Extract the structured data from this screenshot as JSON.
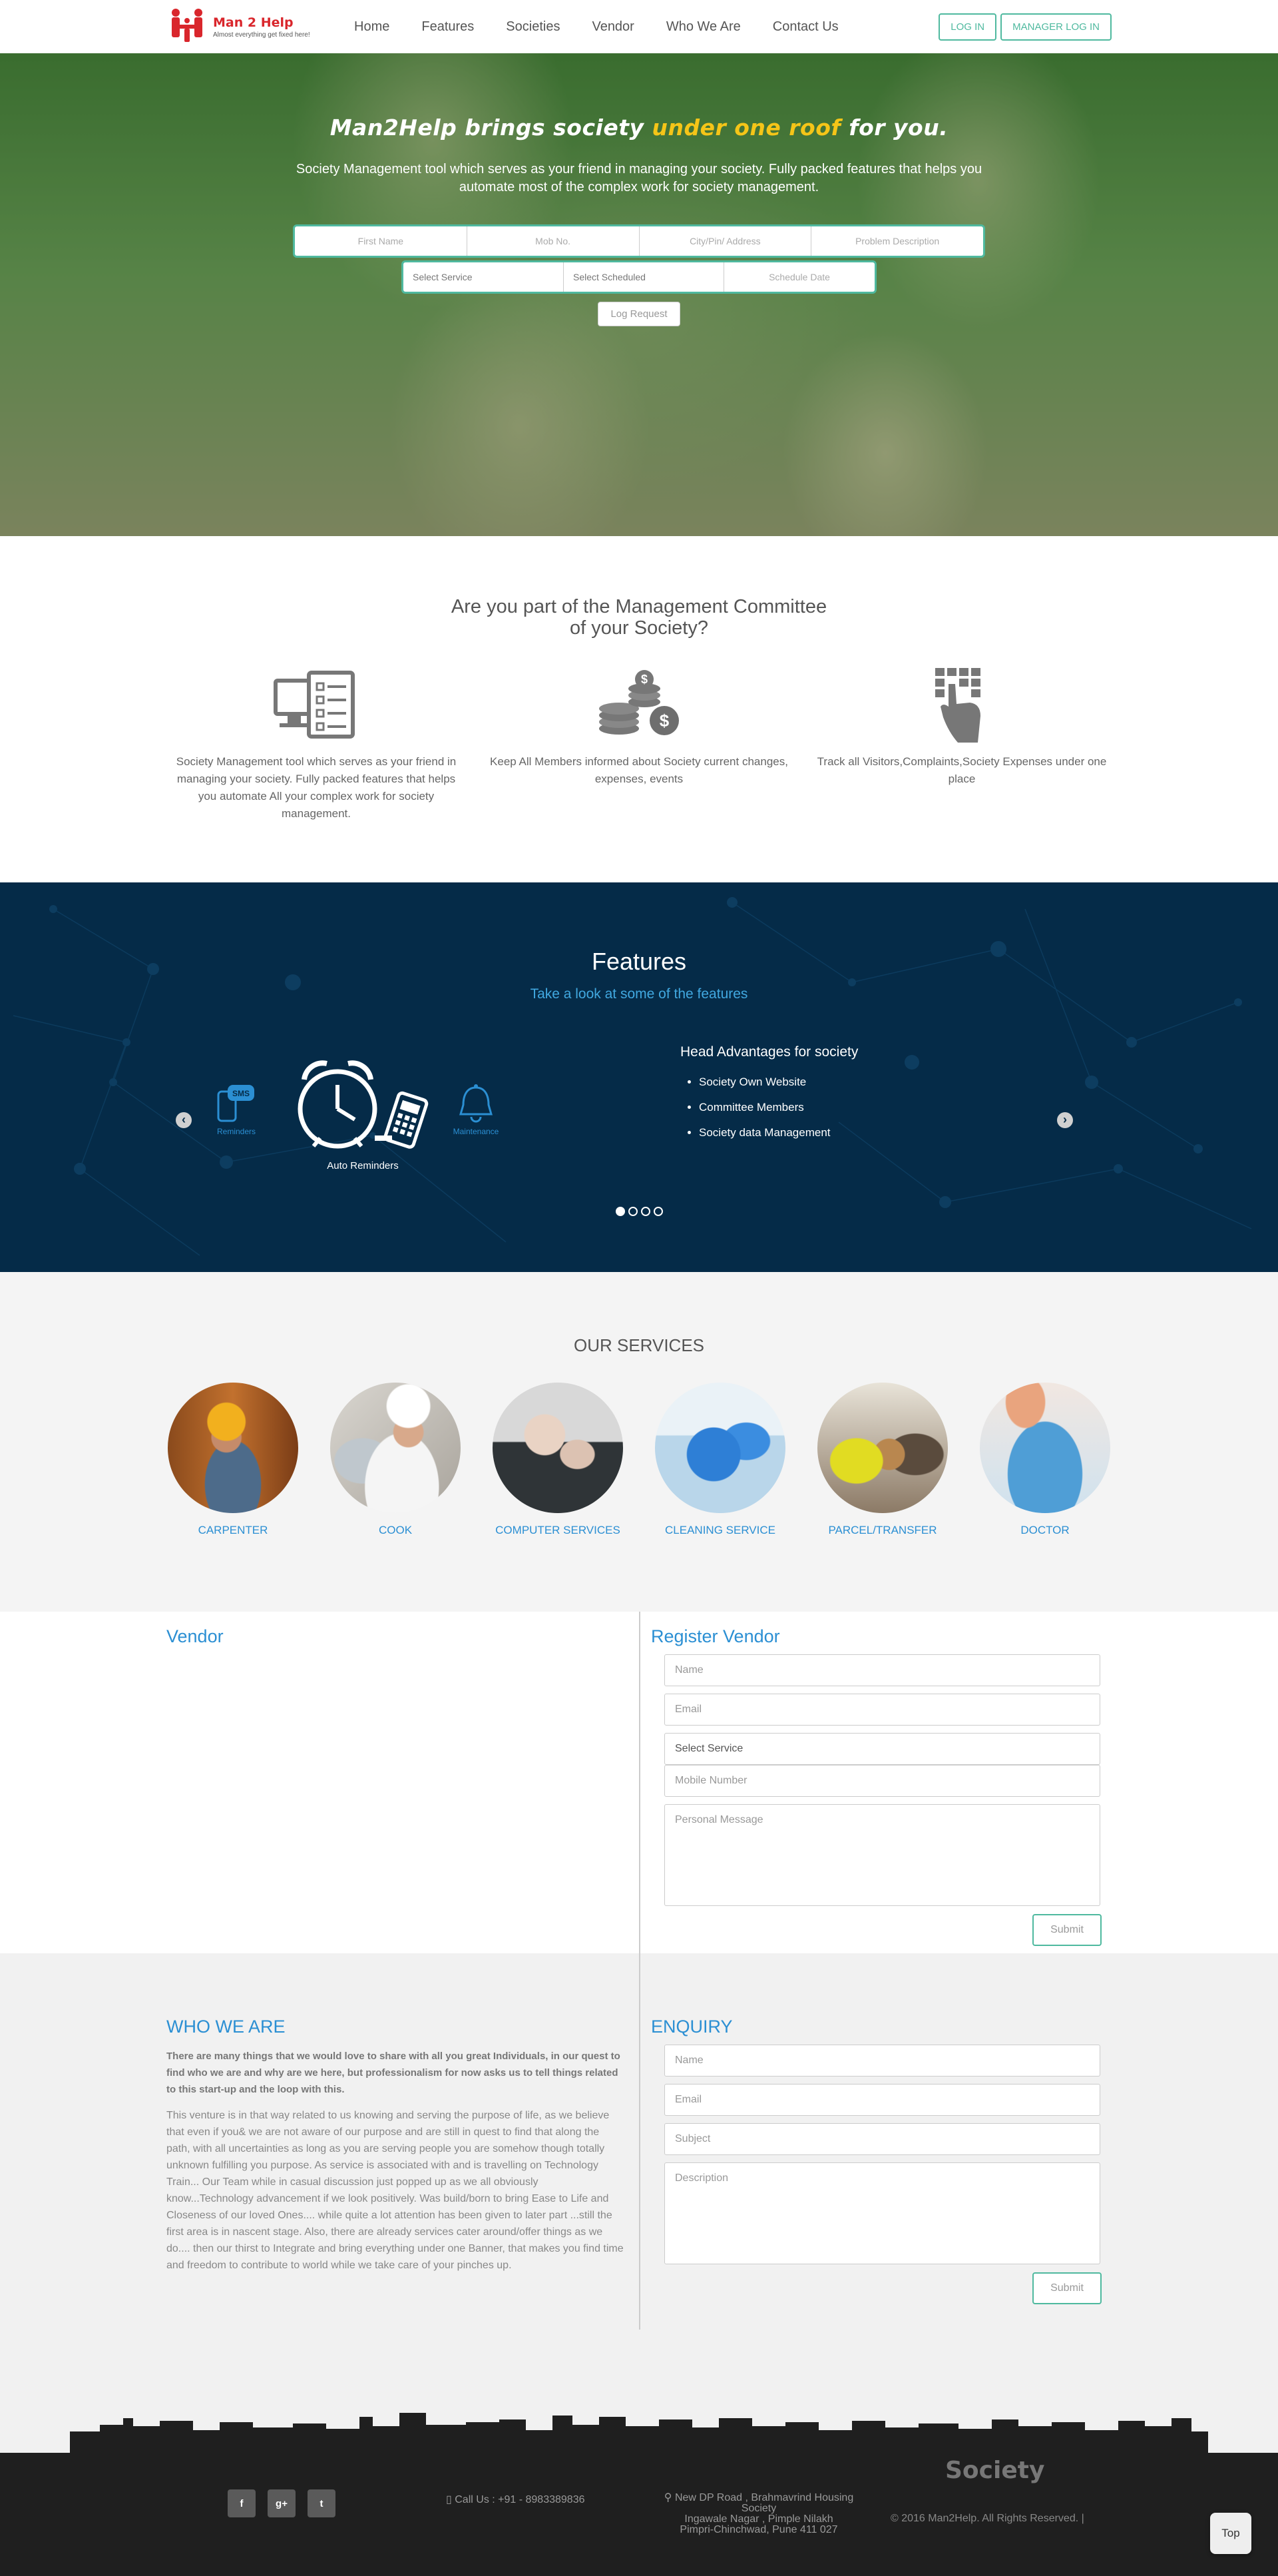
{
  "brand": {
    "name": "Man 2 Help",
    "tagline": "Almost everything get fixed here!"
  },
  "nav": {
    "items": [
      "Home",
      "Features",
      "Societies",
      "Vendor",
      "Who We Are",
      "Contact Us"
    ],
    "login": "LOG IN",
    "manager_login": "MANAGER LOG IN"
  },
  "hero": {
    "title_part1": "Man2Help brings society ",
    "title_highlight": "under one roof",
    "title_part2": " for you.",
    "subtitle": "Society Management tool which serves as your friend in managing your society. Fully packed features that helps you automate most of the complex work for society management.",
    "fields_row1": [
      "First Name",
      "Mob No.",
      "City/Pin/ Address",
      "Problem Description"
    ],
    "fields_row2": [
      "Select Service",
      "Select Scheduled",
      "Schedule Date"
    ],
    "submit": "Log Request"
  },
  "management": {
    "title_line1": "Are you part of the Management Committee",
    "title_line2": "of your Society?",
    "columns": [
      {
        "icon": "checklist-monitor-icon",
        "text": "Society Management tool which serves as your friend in managing your society. Fully packed features that helps you automate All your complex work for society management."
      },
      {
        "icon": "coins-dollar-icon",
        "text": "Keep All Members informed about Society current changes, expenses, events"
      },
      {
        "icon": "hand-keypad-icon",
        "text": "Track all Visitors,Complaints,Society Expenses under one place"
      }
    ]
  },
  "features": {
    "title": "Features",
    "subtitle": "Take a look at some of the features",
    "carousel_items": [
      {
        "label": "Reminders",
        "icon": "sms-phone-icon"
      },
      {
        "label": "Auto Reminders",
        "icon": "alarm-clock-icon"
      },
      {
        "label": "Maintenance",
        "icon": "bell-icon"
      }
    ],
    "advantages_title": "Head Advantages for society",
    "advantages": [
      "Society Own Website",
      "Committee Members",
      "Society data Management"
    ],
    "slide_count": 4,
    "active_slide": 1
  },
  "services": {
    "title": "OUR SERVICES",
    "items": [
      "CARPENTER",
      "COOK",
      "COMPUTER SERVICES",
      "CLEANING SERVICE",
      "PARCEL/TRANSFER",
      "DOCTOR"
    ]
  },
  "vendor": {
    "title": "Vendor",
    "register_title": "Register Vendor",
    "fields": [
      "Name",
      "Email",
      "Select Service",
      "Mobile Number",
      "Personal Message"
    ],
    "submit": "Submit"
  },
  "about": {
    "title": "WHO WE ARE",
    "lead": "There are many things that we would love to share with all you great Individuals, in our quest to find who we are and why are we here, but professionalism for now asks us to tell things related to this start-up and the loop with this.",
    "body": "This venture is in that way related to us knowing and serving the purpose of life, as we believe that even if you& we are not aware of our purpose and are still in quest to find that along the path, with all uncertainties as long as you are serving people you are somehow though totally unknown fulfilling you purpose. As service is associated with and is travelling on Technology Train... Our Team while in casual discussion just popped up as we all obviously know...Technology advancement if we look positively. Was build/born to bring Ease to Life and Closeness of our loved Ones.... while quite a lot attention has been given to later part ...still the first area is in nascent stage. Also, there are already services cater around/offer things as we do.... then our thirst to Integrate and bring everything under one Banner, that makes you find time and freedom to contribute to world while we take care of your pinches up."
  },
  "enquiry": {
    "title": "ENQUIRY",
    "fields": [
      "Name",
      "Email",
      "Subject",
      "Description"
    ],
    "submit": "Submit"
  },
  "footer": {
    "social": [
      "f",
      "g+",
      "t"
    ],
    "call": "Call Us : +91 - 8983389836",
    "address_line1": "New DP Road , Brahmavrind Housing",
    "address_line2": "Society",
    "address_line3": "Ingawale Nagar , Pimple Nilakh",
    "address_line4": "Pimpri-Chinchwad, Pune 411 027",
    "logo_text": "Society",
    "copyright": "© 2016 Man2Help. All Rights Reserved. |",
    "top": "Top"
  },
  "colors": {
    "accent": "#4fb99f",
    "link_blue": "#2b8fd3",
    "features_bg": "#052b48",
    "hero_highlight": "#f5c518"
  }
}
